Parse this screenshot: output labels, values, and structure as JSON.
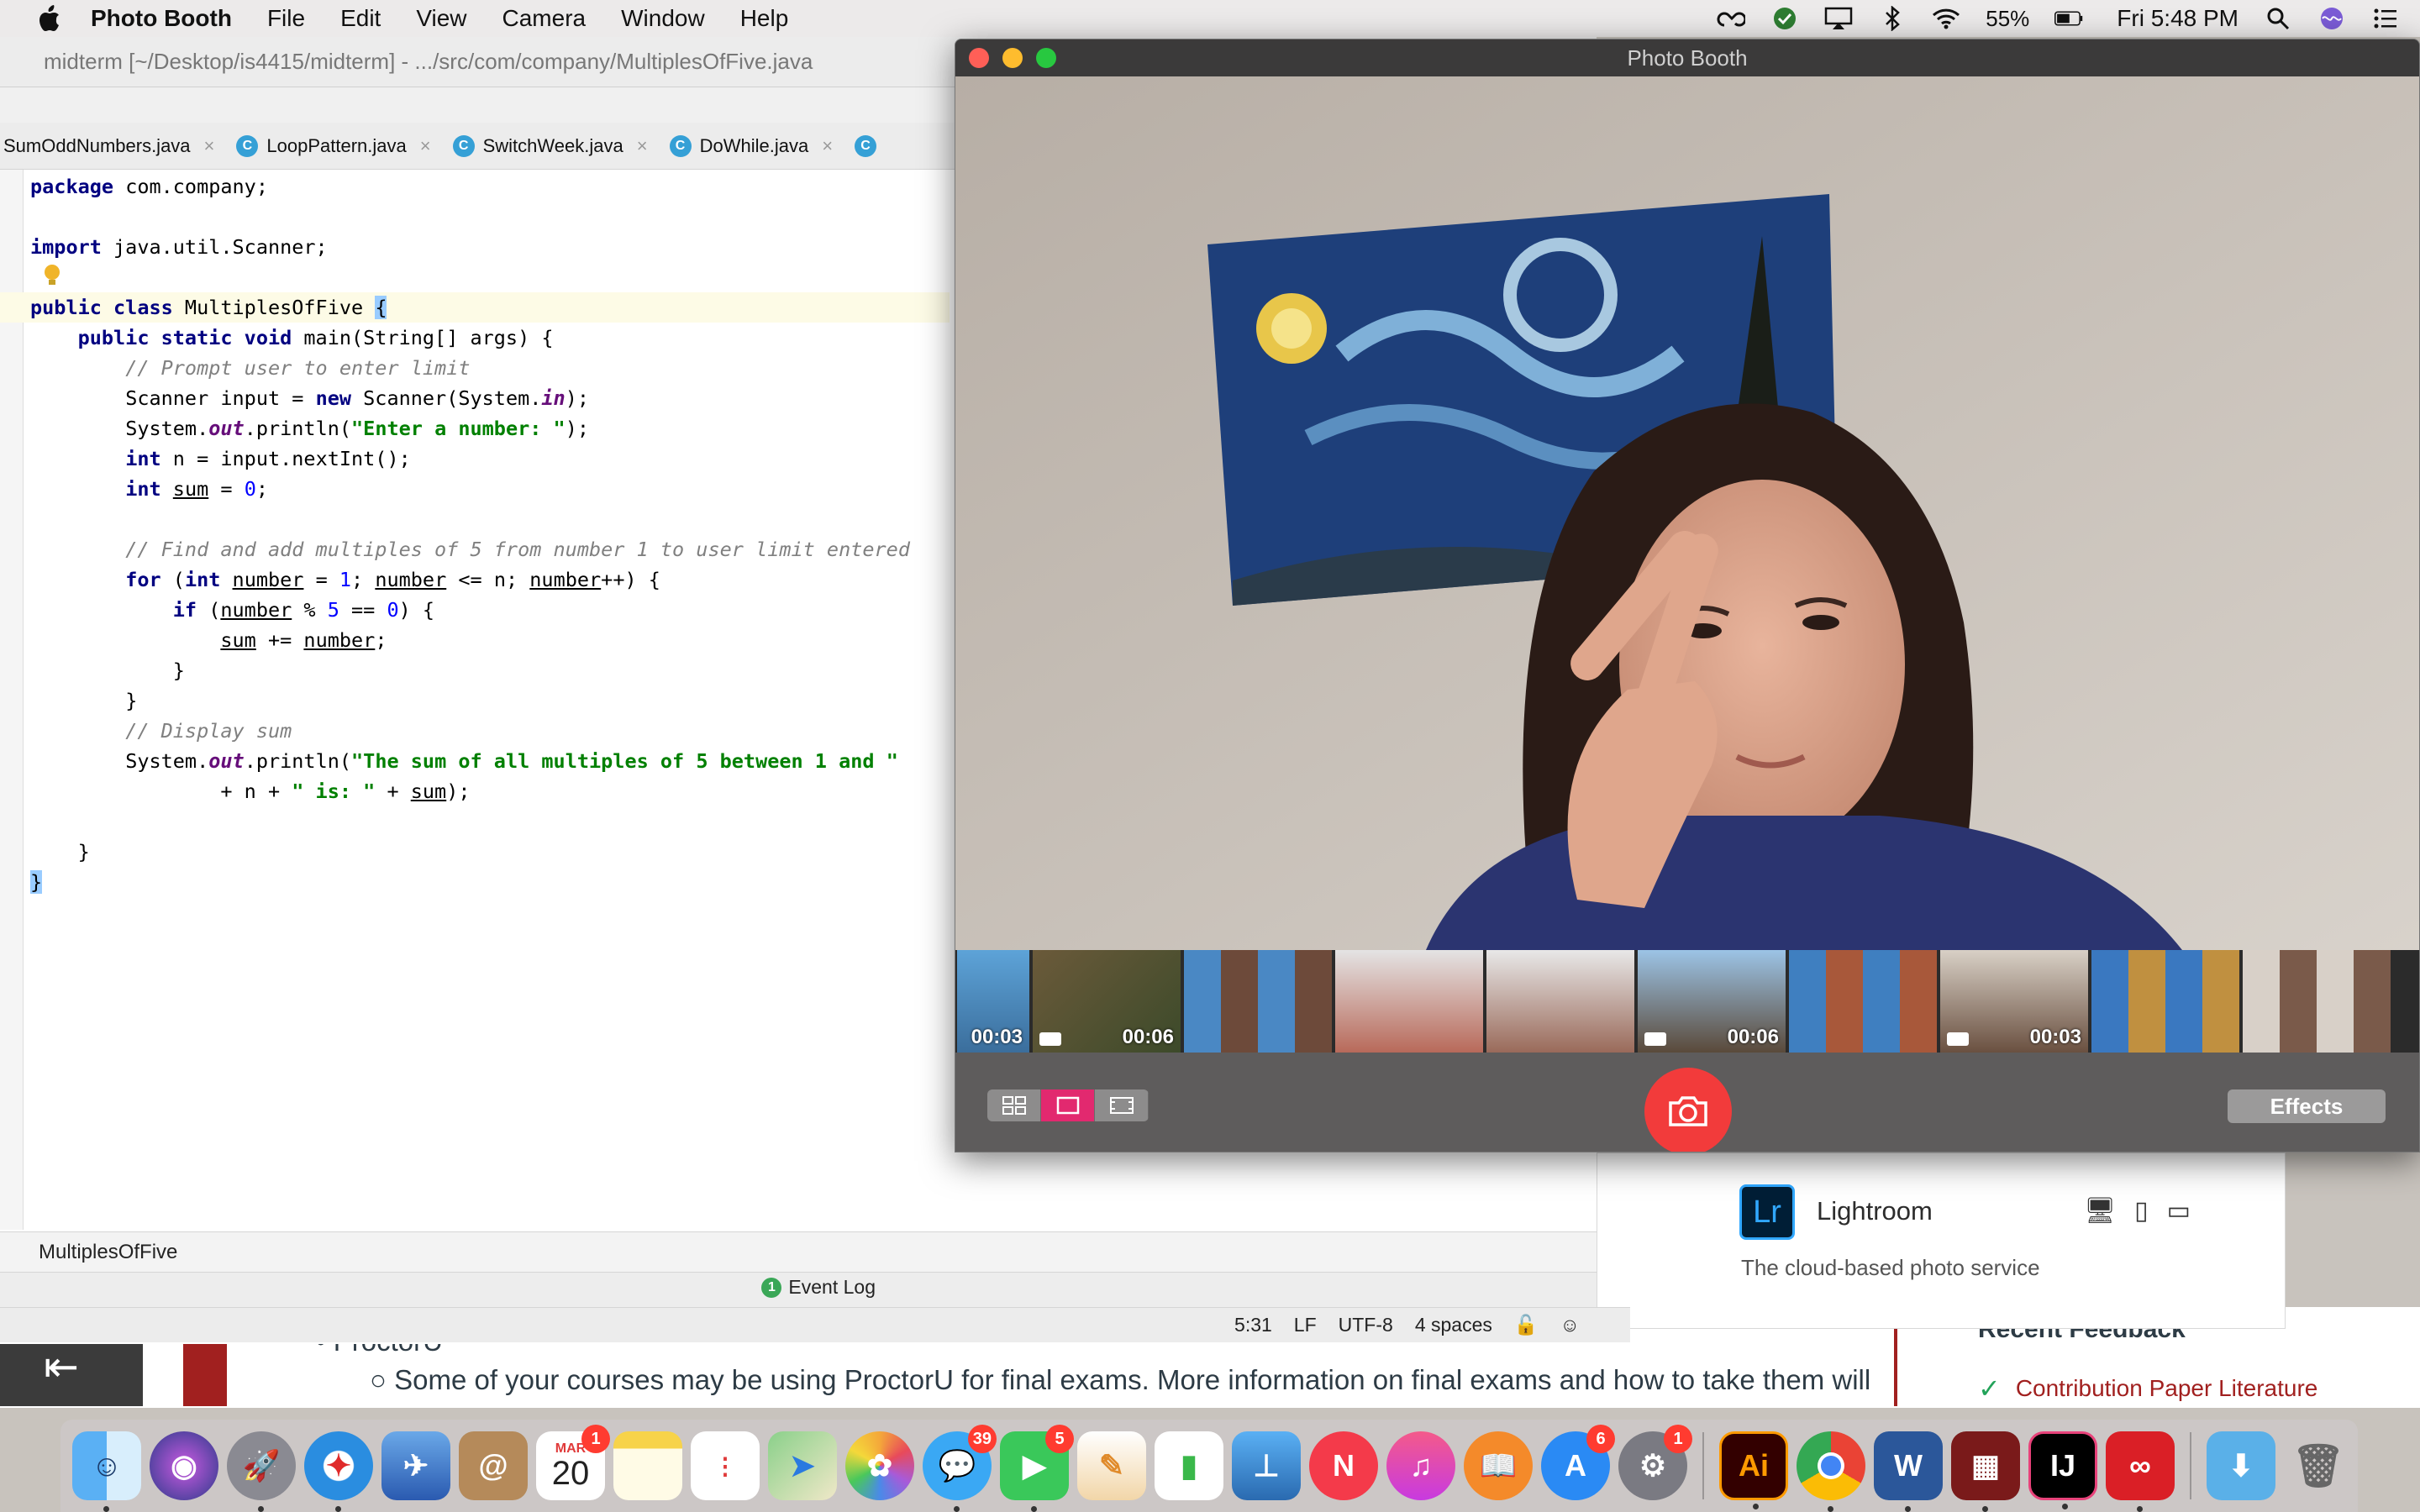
{
  "menubar": {
    "app_name": "Photo Booth",
    "items": [
      "File",
      "Edit",
      "View",
      "Camera",
      "Window",
      "Help"
    ],
    "battery": "55%",
    "clock": "Fri 5:48 PM"
  },
  "ide": {
    "title": "midterm [~/Desktop/is4415/midterm] - .../src/com/company/MultiplesOfFive.java",
    "tabs": [
      "SumOddNumbers.java",
      "LoopPattern.java",
      "SwitchWeek.java",
      "DoWhile.java"
    ],
    "breadcrumb": "MultiplesOfFive",
    "event_log": "Event Log",
    "event_count": "1",
    "status": {
      "position": "5:31",
      "line_sep": "LF",
      "encoding": "UTF-8",
      "indent": "4 spaces"
    },
    "code": {
      "l1_kw": "package",
      "l1_rest": " com.company;",
      "l3_kw": "import",
      "l3_rest": " java.util.Scanner;",
      "l5_kw": "public class",
      "l5_name": " MultiplesOfFive ",
      "l5_brace": "{",
      "l6_kw": "public static void",
      "l6_rest": " main(String[] args) {",
      "l7_cm": "// Prompt user to enter limit",
      "l8_a": "Scanner input = ",
      "l8_kw": "new",
      "l8_b": " Scanner(System.",
      "l8_fld": "in",
      "l8_c": ");",
      "l9_a": "System.",
      "l9_fld": "out",
      "l9_b": ".println(",
      "l9_str": "\"Enter a number: \"",
      "l9_c": ");",
      "l10_kw": "int",
      "l10_rest": " n = input.nextInt();",
      "l11_kw": "int",
      "l11_var": "sum",
      "l11_b": " = ",
      "l11_num": "0",
      "l11_c": ";",
      "l13_cm": "// Find and add multiples of 5 from number 1 to user limit entered",
      "l14_kw": "for",
      "l14_a": " (",
      "l14_kw2": "int",
      "l14_var1": "number",
      "l14_b": " = ",
      "l14_num": "1",
      "l14_c": "; ",
      "l14_var2": "number",
      "l14_d": " <= n; ",
      "l14_var3": "number",
      "l14_e": "++) {",
      "l15_kw": "if",
      "l15_a": " (",
      "l15_var": "number",
      "l15_b": " % ",
      "l15_num1": "5",
      "l15_c": " == ",
      "l15_num2": "0",
      "l15_d": ") {",
      "l16_var1": "sum",
      "l16_a": " += ",
      "l16_var2": "number",
      "l16_b": ";",
      "l17": "}",
      "l18": "}",
      "l19_cm": "// Display sum",
      "l20_a": "System.",
      "l20_fld": "out",
      "l20_b": ".println(",
      "l20_str": "\"The sum of all multiples of 5 between 1 and \"",
      "l21_a": "+ n + ",
      "l21_str": "\" is: \"",
      "l21_b": " + ",
      "l21_var": "sum",
      "l21_c": ");",
      "l23": "}",
      "l24": "}"
    }
  },
  "photobooth": {
    "title": "Photo Booth",
    "effects_label": "Effects",
    "thumb_durations": [
      "00:03",
      "00:06",
      "",
      "",
      "",
      "00:06",
      "",
      "00:03",
      "",
      ""
    ]
  },
  "webpage": {
    "bullet": "ProctorU",
    "sub_bullet": "Some of your courses may be using ProctorU for final exams. More information on final exams and how to take them will",
    "feedback_heading": "Recent Feedback",
    "feedback_item": "Contribution Paper Literature"
  },
  "adobe": {
    "lr_logo": "Lr",
    "lr_name": "Lightroom",
    "lr_desc": "The cloud-based photo service"
  },
  "dock": {
    "calendar_month": "MAR",
    "calendar_day": "20",
    "badges": {
      "calendar": "1",
      "messages": "39",
      "facetime": "5",
      "appstore": "6",
      "prefs": "1"
    },
    "ai_label": "Ai",
    "word_label": "W",
    "intellij_label": "IJ"
  },
  "colors": {
    "shutter": "#f23b3b",
    "view_active": "#e2296f",
    "keyword": "#000080",
    "string": "#008000",
    "number": "#0000ff"
  }
}
